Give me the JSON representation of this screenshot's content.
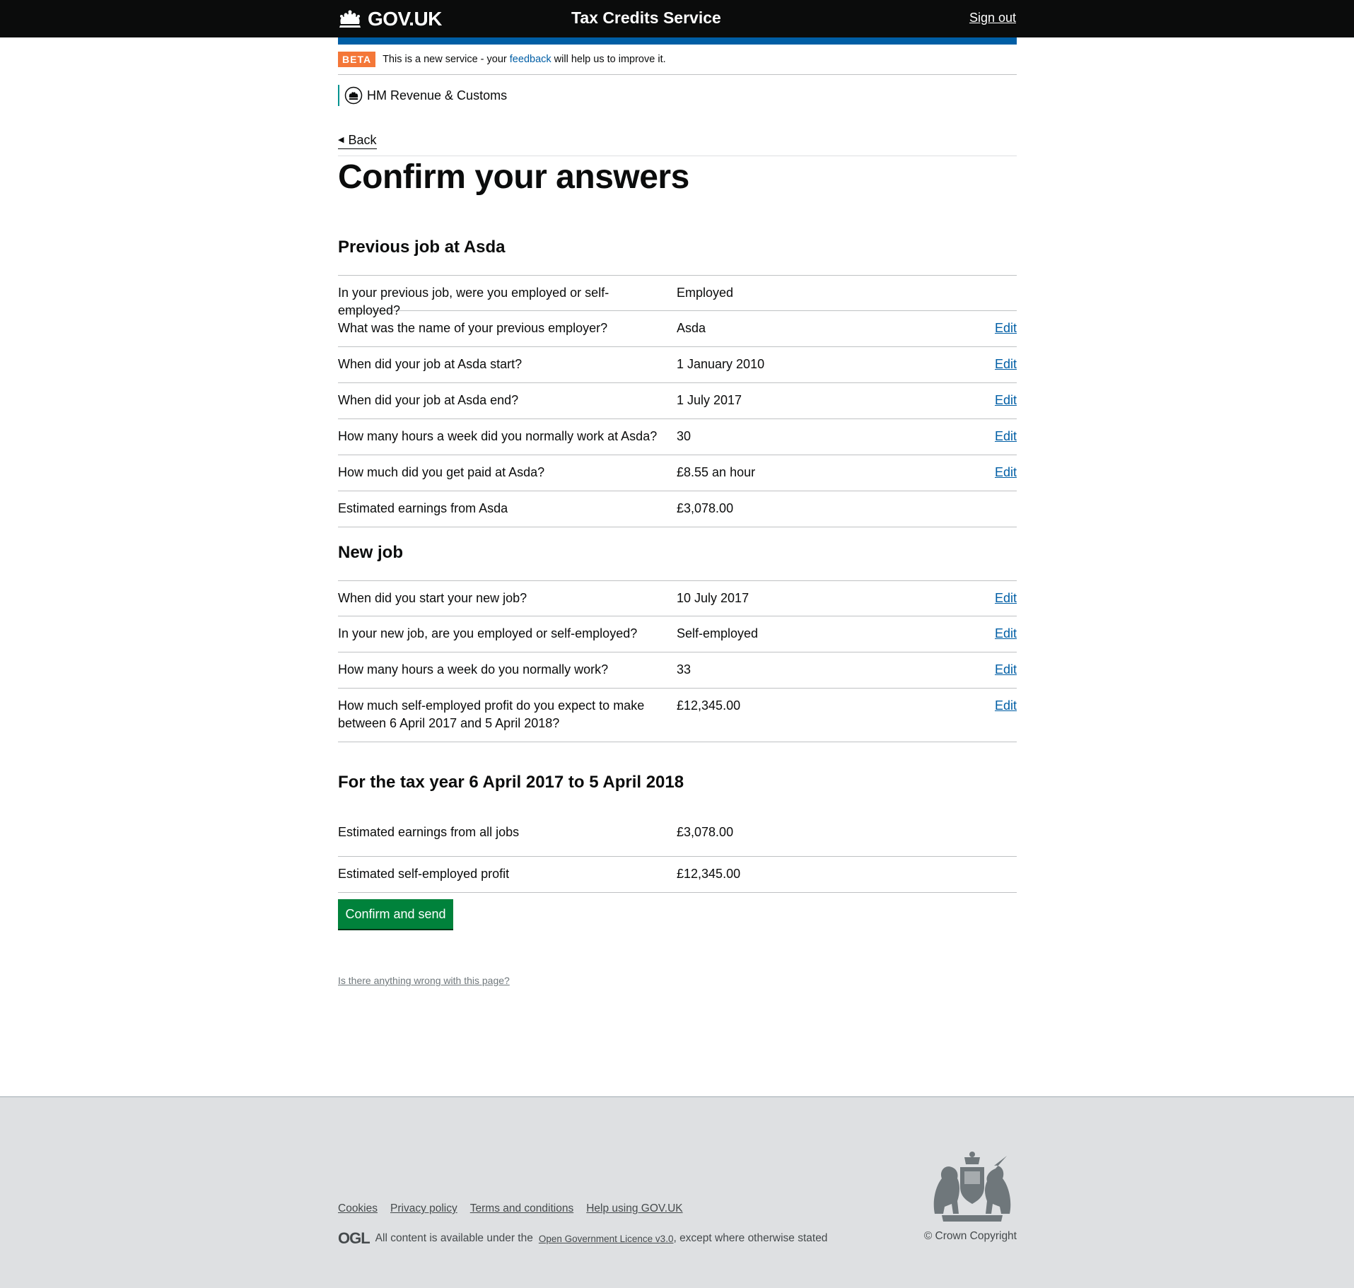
{
  "header": {
    "logo_text": "GOV.UK",
    "service_name": "Tax Credits Service",
    "sign_out": "Sign out"
  },
  "phase_banner": {
    "tag": "BETA",
    "text_before": "This is a new service - your",
    "link": "feedback",
    "text_after": "will help us to improve it."
  },
  "organisation": "HM Revenue & Customs",
  "back_link": "Back",
  "page_title": "Confirm your answers",
  "sections": [
    {
      "heading": "Previous job at Asda",
      "rows": [
        {
          "question": "In your previous job, were you employed or self-employed?",
          "answer": "Employed",
          "edit": ""
        },
        {
          "question": "What was the name of your previous employer?",
          "answer": "Asda",
          "edit": "Edit"
        },
        {
          "question": "When did your job at Asda start?",
          "answer": "1 January 2010",
          "edit": "Edit"
        },
        {
          "question": "When did your job at Asda end?",
          "answer": "1 July 2017",
          "edit": "Edit"
        },
        {
          "question": "How many hours a week did you normally work at Asda?",
          "answer": "30",
          "edit": "Edit"
        },
        {
          "question": "How much did you get paid at Asda?",
          "answer": "£8.55 an hour",
          "edit": "Edit"
        },
        {
          "question": "Estimated earnings from Asda",
          "answer": "£3,078.00",
          "edit": ""
        }
      ]
    },
    {
      "heading": "New job",
      "rows": [
        {
          "question": "When did you start your new job?",
          "answer": "10 July 2017",
          "edit": "Edit"
        },
        {
          "question": "In your new job, are you employed or self-employed?",
          "answer": "Self-employed",
          "edit": "Edit"
        },
        {
          "question": "How many hours a week do you normally work?",
          "answer": "33",
          "edit": "Edit"
        },
        {
          "question": "How much self-employed profit do you expect to make between 6 April 2017 and 5 April 2018?",
          "answer": "£12,345.00",
          "edit": "Edit"
        }
      ]
    },
    {
      "heading": "For the tax year 6 April 2017 to 5 April 2018",
      "rows": [
        {
          "question": "Estimated earnings from all jobs",
          "answer": "£3,078.00",
          "edit": ""
        },
        {
          "question": "Estimated self-employed profit",
          "answer": "£12,345.00",
          "edit": ""
        }
      ]
    }
  ],
  "confirm_button": "Confirm and send",
  "report_link": "Is there anything wrong with this page?",
  "footer": {
    "links": [
      "Cookies",
      "Privacy policy",
      "Terms and conditions",
      "Help using GOV.UK"
    ],
    "ogl": "OGL",
    "licence_before": "All content is available under the",
    "licence_link": "Open Government Licence v3.0",
    "licence_after": ", except where otherwise stated",
    "copyright": "© Crown Copyright"
  },
  "colors": {
    "header_bg": "#0b0c0c",
    "brand_blue": "#005ea5",
    "beta_tag": "#f47738",
    "button_green": "#00823b",
    "footer_bg": "#dee0e2"
  }
}
